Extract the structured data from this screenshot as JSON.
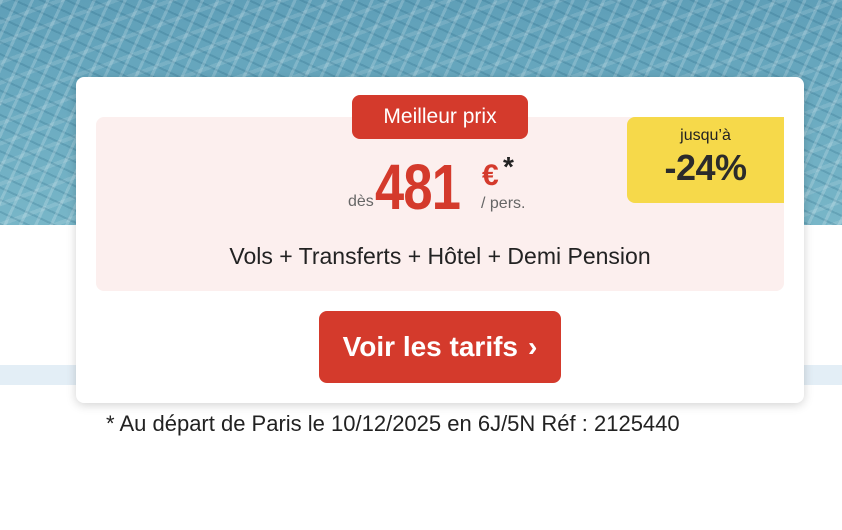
{
  "offer": {
    "badge": "Meilleur prix",
    "discount_prefix": "jusqu’à",
    "discount_value": "-24%",
    "price_from": "dès",
    "price_amount": "481",
    "price_currency": "€",
    "price_asterisk": "*",
    "price_unit": "/ pers.",
    "formula": "Vols + Transferts + Hôtel + Demi Pension"
  },
  "cta": {
    "label": "Voir les tarifs",
    "icon": "chevron-right-icon"
  },
  "footnote": "* Au départ de Paris le 10/12/2025 en 6J/5N Réf : 2125440",
  "colors": {
    "accent": "#d43a2c",
    "discount_bg": "#f6d94a",
    "offer_bg": "#fcefee",
    "band": "#e3eef6"
  }
}
